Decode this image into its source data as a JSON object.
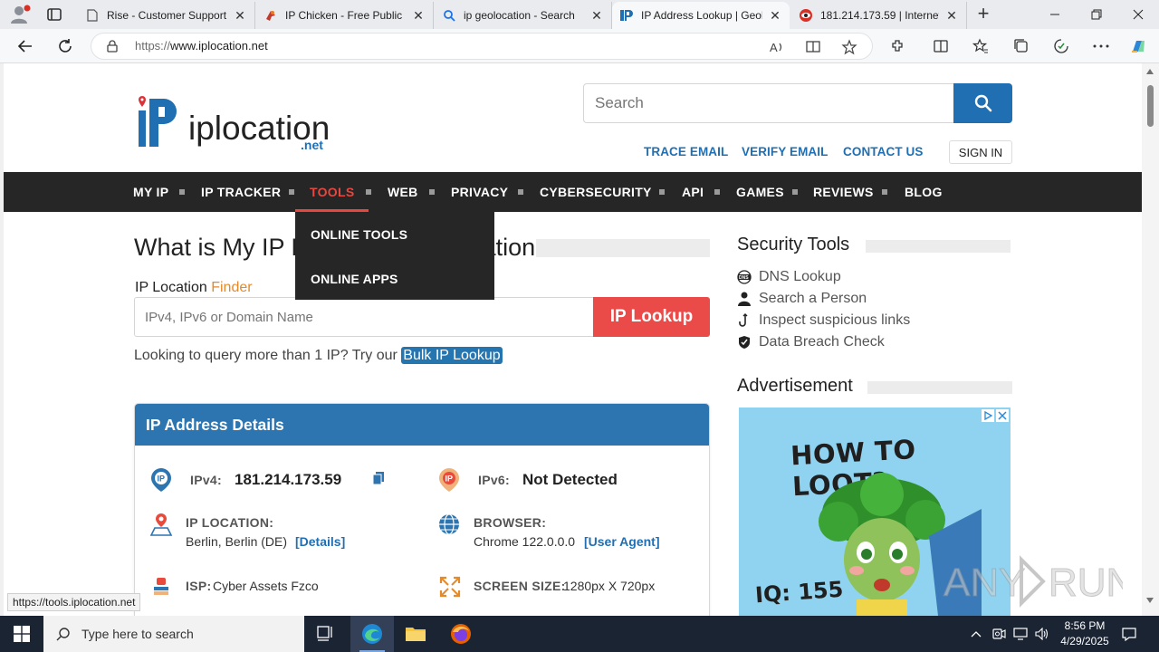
{
  "browser": {
    "tabs": [
      {
        "title": "Rise - Customer Support",
        "active": false
      },
      {
        "title": "IP Chicken - Free Public I",
        "active": false
      },
      {
        "title": "ip geolocation - Search",
        "active": false
      },
      {
        "title": "IP Address Lookup | Geol",
        "active": true
      },
      {
        "title": "181.214.173.59 | Internet",
        "active": false
      }
    ],
    "url_scheme": "https://",
    "url_host": "www.iplocation.net",
    "status_url": "https://tools.iplocation.net"
  },
  "header": {
    "logo_text": "iplocation",
    "logo_suffix": ".net",
    "search_placeholder": "Search",
    "links": [
      "TRACE EMAIL",
      "VERIFY EMAIL",
      "CONTACT US"
    ],
    "signin": "SIGN IN"
  },
  "nav": {
    "items": [
      "MY IP",
      "IP TRACKER",
      "TOOLS",
      "WEB",
      "PRIVACY",
      "CYBERSECURITY",
      "API",
      "GAMES",
      "REVIEWS",
      "BLOG"
    ],
    "active": "TOOLS",
    "dropdown": [
      "ONLINE TOOLS",
      "ONLINE APPS"
    ]
  },
  "main": {
    "heading": "What is My IP L",
    "heading_tail": "ation",
    "finder_prefix": "IP Location ",
    "finder_highlight": "Finder",
    "input_placeholder": "IPv4, IPv6 or Domain Name",
    "lookup_button": "IP Lookup",
    "bulk_text": "Looking to query more than 1 IP? Try our ",
    "bulk_link": "Bulk IP Lookup",
    "details": {
      "title": "IP Address Details",
      "ipv4_label": "IPv4:",
      "ipv4_value": "181.214.173.59",
      "ipv6_label": "IPv6:",
      "ipv6_value": "Not Detected",
      "location_label": "IP LOCATION:",
      "location_value": "Berlin, Berlin (DE)",
      "location_link": "[Details]",
      "browser_label": "BROWSER:",
      "browser_value": "Chrome 122.0.0.0",
      "browser_link": "[User Agent]",
      "isp_label": "ISP:",
      "isp_value": "Cyber Assets Fzco",
      "screen_label": "SCREEN SIZE:",
      "screen_value": "1280px X 720px"
    }
  },
  "sidebar": {
    "security_title": "Security Tools",
    "security_items": [
      "DNS Lookup",
      "Search a Person",
      "Inspect suspicious links",
      "Data Breach Check"
    ],
    "ad_title": "Advertisement",
    "ad_headline": "HOW TO LOOT?",
    "ad_iq": "IQ: 155"
  },
  "watermark": "ANY RUN",
  "taskbar": {
    "search_placeholder": "Type here to search",
    "time": "8:56 PM",
    "date": "4/29/2025"
  },
  "colors": {
    "brand_blue": "#1f6fb2",
    "accent_red": "#e8473f",
    "nav_bg": "#262626",
    "card_head": "#2d75b0"
  }
}
